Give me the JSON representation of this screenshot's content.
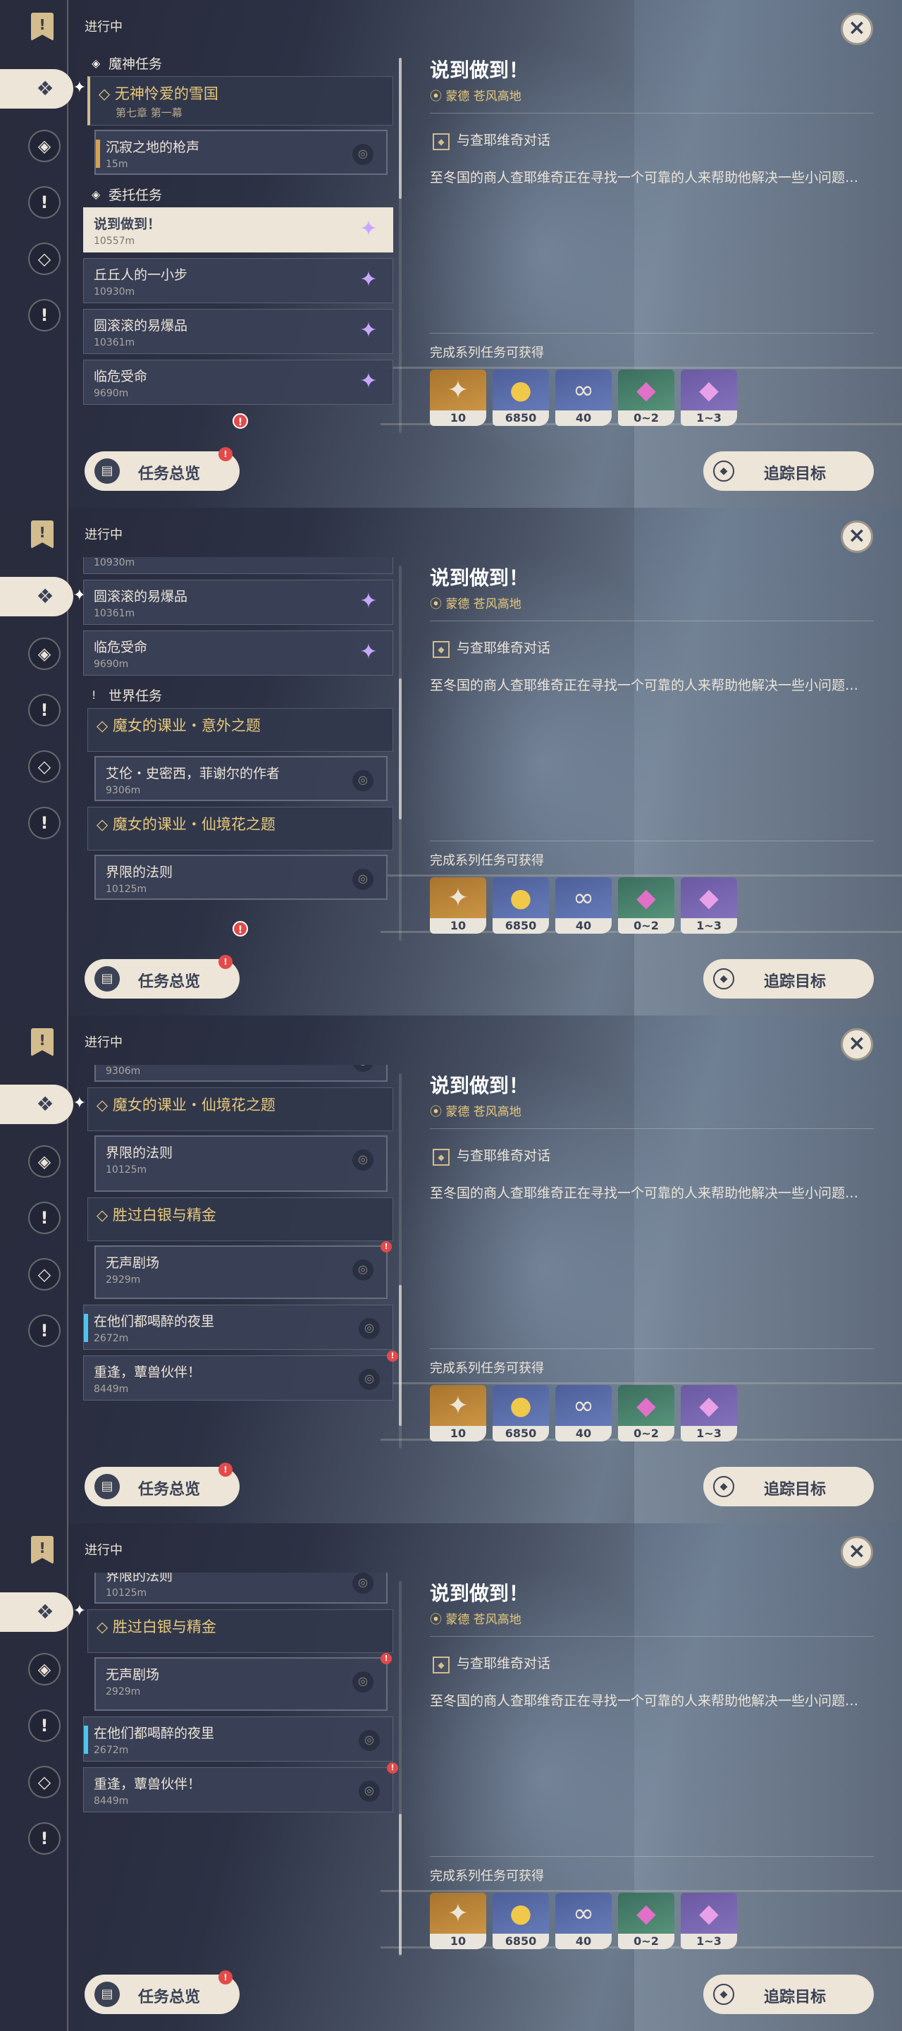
{
  "header": {
    "in_progress": "进行中",
    "close_icon": "close-icon"
  },
  "sections": {
    "archon": "魔神任务",
    "commission": "委托任务",
    "world": "世界任务"
  },
  "quests": {
    "archon_group_title": "无神怜爱的雪国",
    "archon_group_sub": "第七章 第一幕",
    "silent": {
      "title": "沉寂之地的枪声",
      "dist": "15m"
    },
    "said_done": {
      "title": "说到做到！",
      "dist": "10557m"
    },
    "hill": {
      "title": "丘丘人的一小步",
      "dist": "10930m"
    },
    "round": {
      "title": "圆滚滚的易爆品",
      "dist": "10361m"
    },
    "peril": {
      "title": "临危受命",
      "dist": "9690m"
    },
    "witch1_group": "魔女的课业・意外之题",
    "allen": {
      "title": "艾伦・史密西，菲谢尔的作者",
      "dist": "9306m"
    },
    "witch2_group": "魔女的课业・仙境花之题",
    "boundary": {
      "title": "界限的法则",
      "dist": "10125m"
    },
    "silver_group": "胜过白银与精金",
    "silent_theater": {
      "title": "无声剧场",
      "dist": "2929m"
    },
    "drunk_night": {
      "title": "在他们都喝醉的夜里",
      "dist": "2672m"
    },
    "reunion": {
      "title": "重逢，蕈兽伙伴！",
      "dist": "8449m"
    }
  },
  "buttons": {
    "overview": "任务总览",
    "track": "追踪目标"
  },
  "detail": {
    "title": "说到做到！",
    "location": "蒙德 苍风高地",
    "objective": "与查耶维奇对话",
    "description": "至冬国的商人查耶维奇正在寻找一个可靠的人来帮助他解决一些小问题…",
    "rewards_label": "完成系列任务可获得",
    "rewards": [
      {
        "icon": "primogem-icon",
        "count": "10",
        "color": "#c88e3a"
      },
      {
        "icon": "mora-icon",
        "count": "6850",
        "color": "#5a6ba8"
      },
      {
        "icon": "exp-icon",
        "count": "40",
        "color": "#5a6ba8"
      },
      {
        "icon": "crystal-icon",
        "count": "0~2",
        "color": "#4a8670"
      },
      {
        "icon": "crystal-chunk-icon",
        "count": "1~3",
        "color": "#7a68b4"
      }
    ]
  },
  "colors": {
    "gold": "#d3bc8e",
    "cream": "#ece5d8",
    "dark": "#3b4255",
    "alert": "#e34a4a",
    "blue_marker": "#4ec4ef"
  }
}
